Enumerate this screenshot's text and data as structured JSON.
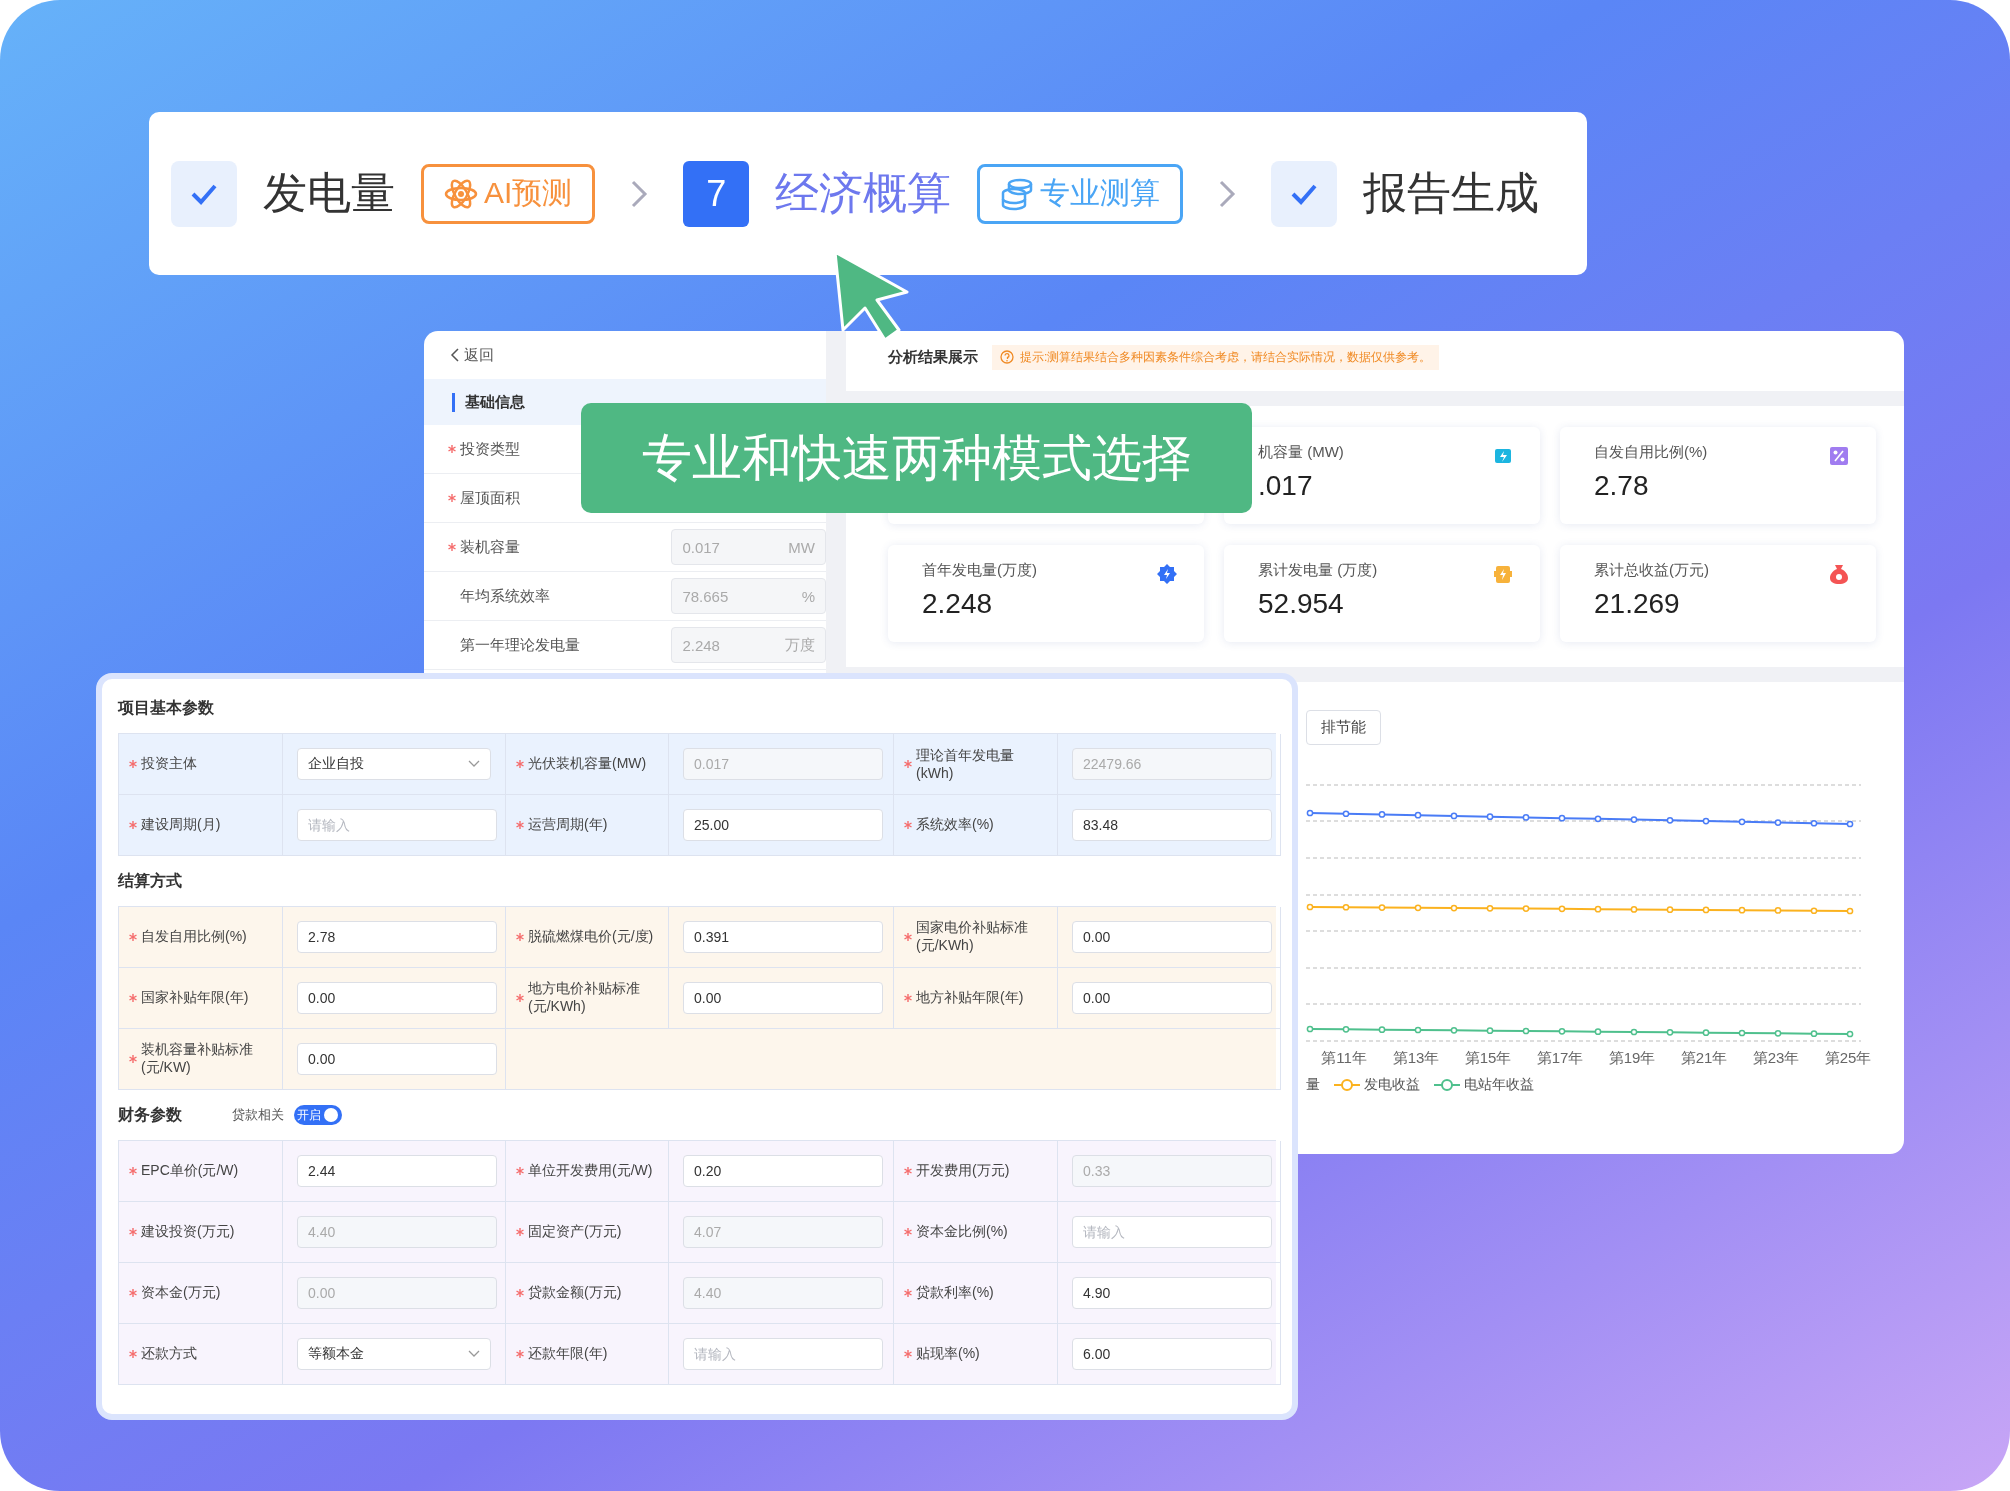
{
  "steps": [
    {
      "kind": "done",
      "label": "发电量",
      "badge": {
        "kind": "ai",
        "label": "AI预测"
      }
    },
    {
      "kind": "current",
      "number": "7",
      "label": "经济概算",
      "badge": {
        "kind": "pro",
        "label": "专业测算"
      }
    },
    {
      "kind": "done",
      "label": "报告生成"
    }
  ],
  "banner": {
    "text": "专业和快速两种模式选择"
  },
  "basic_info": {
    "back": "返回",
    "section": "基础信息",
    "rows": [
      {
        "label": "投资类型",
        "required": true
      },
      {
        "label": "屋顶面积",
        "required": true
      },
      {
        "label": "装机容量",
        "required": true,
        "value": "0.017",
        "unit": "MW"
      },
      {
        "label": "年均系统效率",
        "required": false,
        "value": "78.665",
        "unit": "%"
      },
      {
        "label": "第一年理论发电量",
        "required": false,
        "value": "2.248",
        "unit": "万度"
      }
    ]
  },
  "results": {
    "title": "分析结果展示",
    "tip": "提示:测算结果结合多种因素条件综合考虑，请结合实际情况，数据仅供参考。",
    "cards": [
      {
        "label": "机容量 (MW)",
        "value": ".017"
      },
      {
        "label": "自发自用比例(%)",
        "value": "2.78"
      },
      {
        "label": "首年发电量(万度)",
        "value": "2.248"
      },
      {
        "label": "累计发电量 (万度)",
        "value": "52.954"
      },
      {
        "label": "累计总收益(万元)",
        "value": "21.269"
      }
    ],
    "chart_tab": "排节能",
    "x_labels": [
      "第11年",
      "第13年",
      "第15年",
      "第17年",
      "第19年",
      "第21年",
      "第23年",
      "第25年"
    ],
    "legend": [
      {
        "label": "量"
      },
      {
        "label": "发电收益",
        "color": "#fbb21f"
      },
      {
        "label": "电站年收益",
        "color": "#4fc08d"
      }
    ]
  },
  "form": {
    "sections": [
      {
        "title": "项目基本参数",
        "rows": [
          [
            {
              "label": "投资主体",
              "required": true,
              "kind": "select",
              "value": "企业自投"
            },
            {
              "label": "光伏装机容量(MW)",
              "required": true,
              "kind": "readonly",
              "value": "0.017"
            },
            {
              "label": "理论首年发电量(kWh)",
              "required": true,
              "kind": "readonly",
              "value": "22479.66"
            }
          ],
          [
            {
              "label": "建设周期(月)",
              "required": true,
              "kind": "input",
              "placeholder": "请输入"
            },
            {
              "label": "运营周期(年)",
              "required": true,
              "kind": "input",
              "value": "25.00"
            },
            {
              "label": "系统效率(%)",
              "required": true,
              "kind": "input",
              "value": "83.48"
            }
          ]
        ]
      },
      {
        "title": "结算方式",
        "rows": [
          [
            {
              "label": "自发自用比例(%)",
              "required": true,
              "kind": "input",
              "value": "2.78"
            },
            {
              "label": "脱硫燃煤电价(元/度)",
              "required": true,
              "kind": "input",
              "value": "0.391"
            },
            {
              "label": "国家电价补贴标准(元/KWh)",
              "required": true,
              "kind": "input",
              "value": "0.00"
            }
          ],
          [
            {
              "label": "国家补贴年限(年)",
              "required": true,
              "kind": "input",
              "value": "0.00"
            },
            {
              "label": "地方电价补贴标准(元/KWh)",
              "required": true,
              "kind": "input",
              "value": "0.00"
            },
            {
              "label": "地方补贴年限(年)",
              "required": true,
              "kind": "input",
              "value": "0.00"
            }
          ],
          [
            {
              "label": "装机容量补贴标准(元/KW)",
              "required": true,
              "kind": "input",
              "value": "0.00"
            }
          ]
        ]
      },
      {
        "title": "财务参数",
        "switch": {
          "label": "贷款相关",
          "text": "开启",
          "on": true
        },
        "rows": [
          [
            {
              "label": "EPC单价(元/W)",
              "required": true,
              "kind": "input",
              "value": "2.44"
            },
            {
              "label": "单位开发费用(元/W)",
              "required": true,
              "kind": "input",
              "value": "0.20"
            },
            {
              "label": "开发费用(万元)",
              "required": true,
              "kind": "readonly",
              "value": "0.33"
            }
          ],
          [
            {
              "label": "建设投资(万元)",
              "required": true,
              "kind": "readonly",
              "value": "4.40"
            },
            {
              "label": "固定资产(万元)",
              "required": true,
              "kind": "readonly",
              "value": "4.07"
            },
            {
              "label": "资本金比例(%)",
              "required": true,
              "kind": "input",
              "placeholder": "请输入"
            }
          ],
          [
            {
              "label": "资本金(万元)",
              "required": true,
              "kind": "readonly",
              "value": "0.00"
            },
            {
              "label": "贷款金额(万元)",
              "required": true,
              "kind": "readonly",
              "value": "4.40"
            },
            {
              "label": "贷款利率(%)",
              "required": true,
              "kind": "input",
              "value": "4.90"
            }
          ],
          [
            {
              "label": "还款方式",
              "required": true,
              "kind": "select",
              "value": "等额本金"
            },
            {
              "label": "还款年限(年)",
              "required": true,
              "kind": "input",
              "placeholder": "请输入"
            },
            {
              "label": "贴现率(%)",
              "required": true,
              "kind": "input",
              "value": "6.00"
            }
          ]
        ]
      }
    ]
  }
}
